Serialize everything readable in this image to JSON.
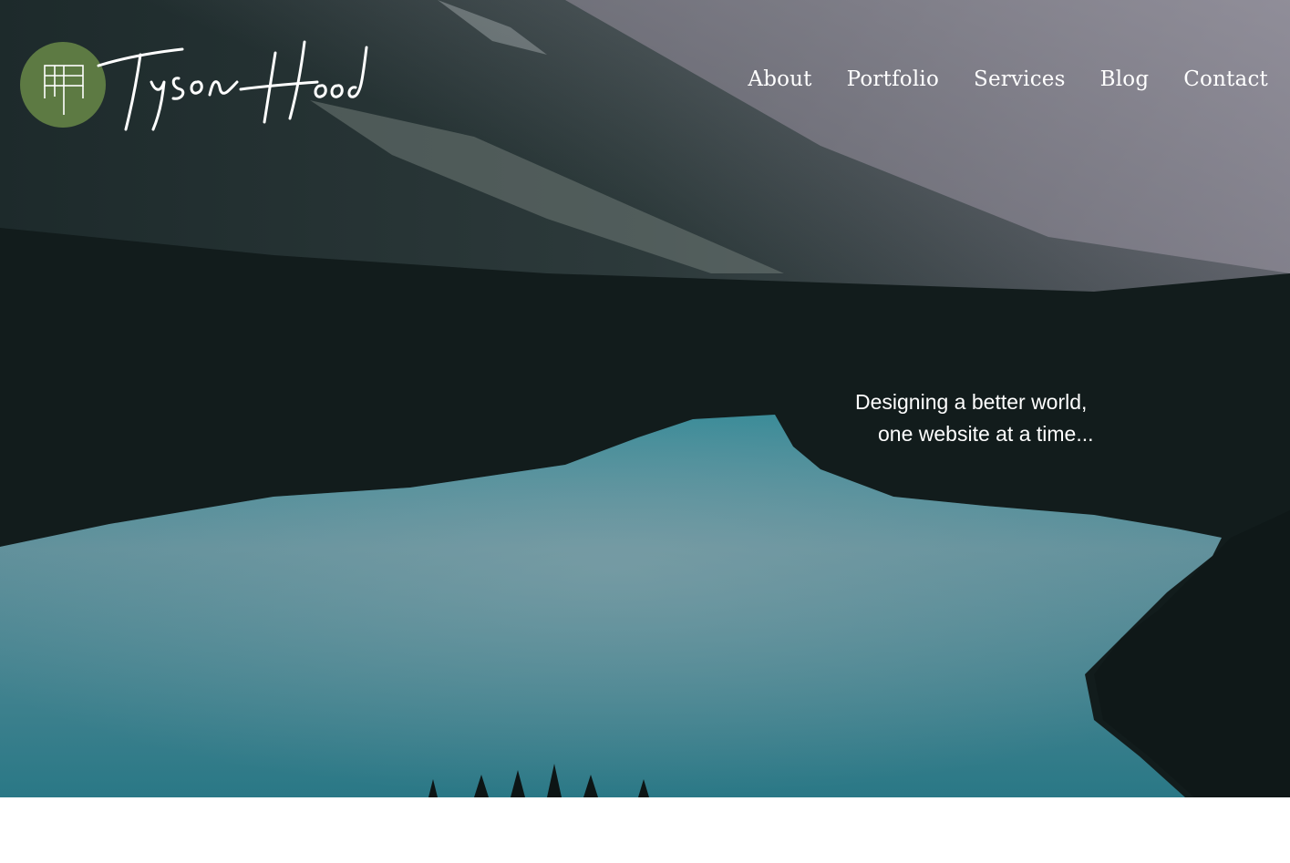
{
  "brand": {
    "name": "Tyson Hood",
    "logo_color": "#5d7a43"
  },
  "nav": {
    "items": [
      {
        "label": "About"
      },
      {
        "label": "Portfolio"
      },
      {
        "label": "Services"
      },
      {
        "label": "Blog"
      },
      {
        "label": "Contact"
      }
    ]
  },
  "hero": {
    "tagline_line1": "Designing a better world,",
    "tagline_line2": "one website at a time...",
    "lake_color": "#2f8a96",
    "forest_color": "#121c1c"
  }
}
